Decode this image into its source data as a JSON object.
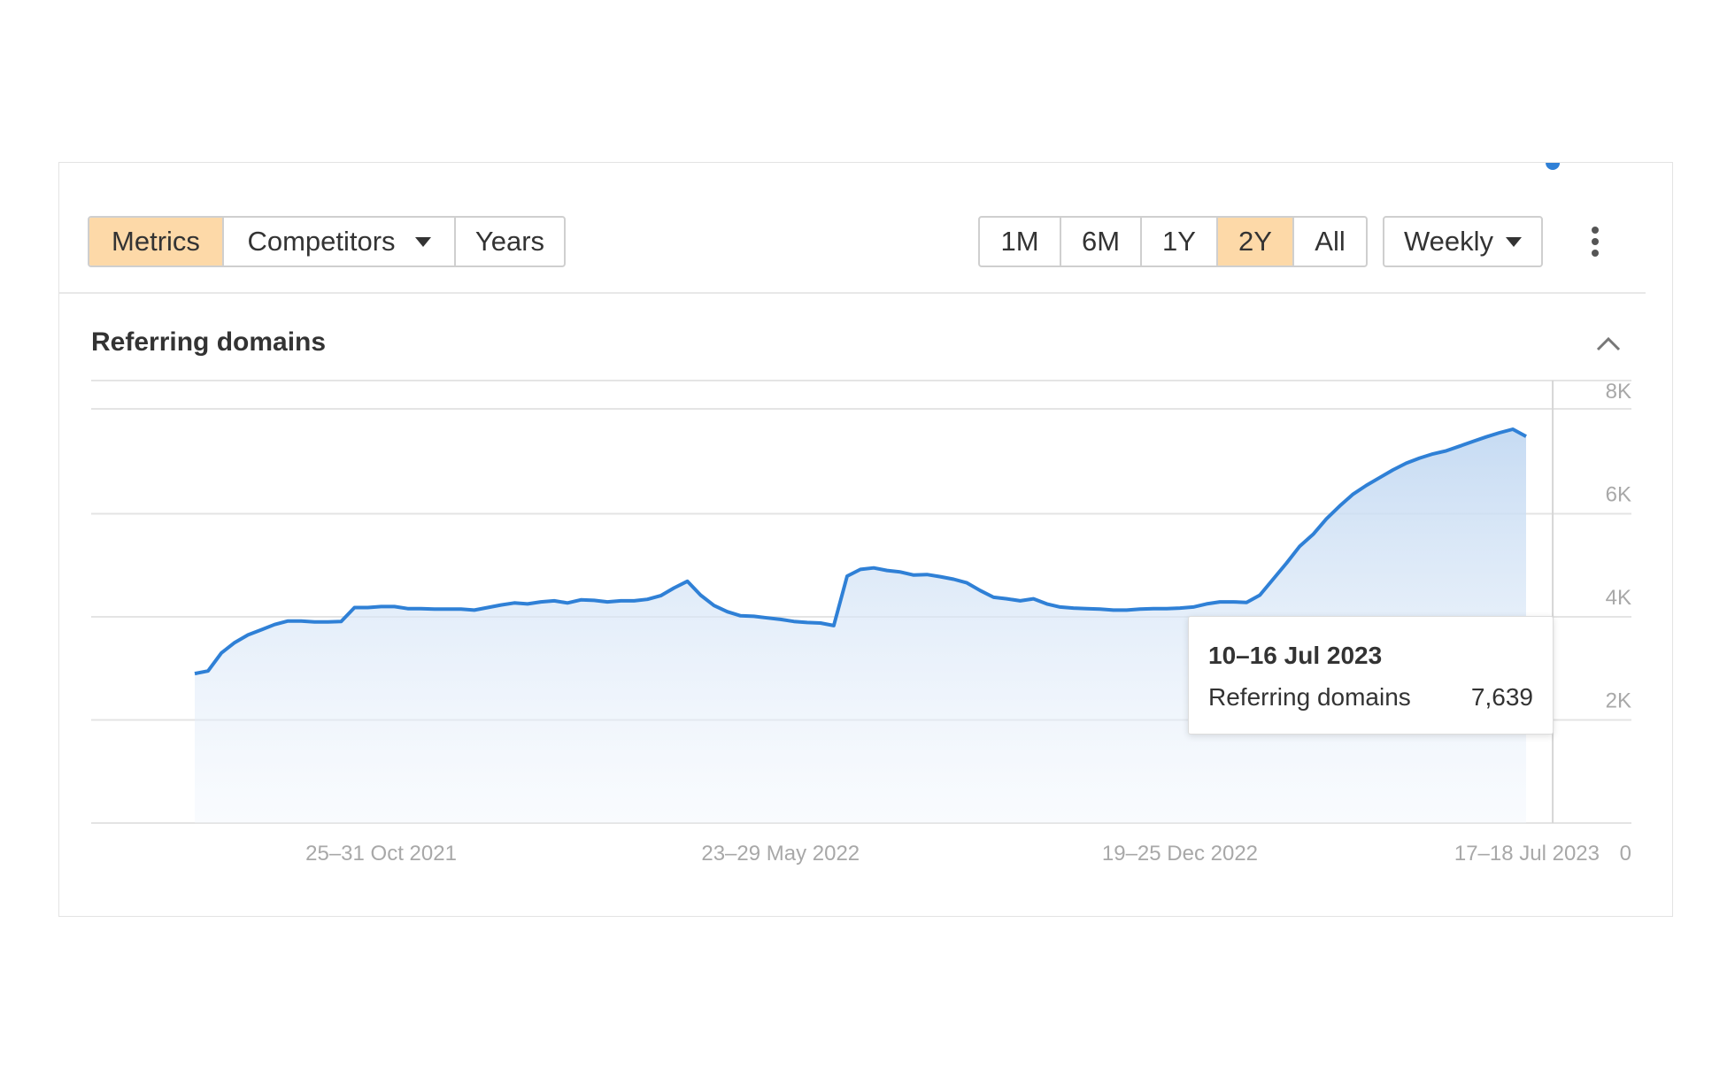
{
  "toolbar": {
    "view_tabs": [
      {
        "label": "Metrics",
        "active": true
      },
      {
        "label": "Competitors",
        "active": false
      },
      {
        "label": "Years",
        "active": false
      }
    ],
    "ranges": [
      {
        "label": "1M",
        "active": false
      },
      {
        "label": "6M",
        "active": false
      },
      {
        "label": "1Y",
        "active": false
      },
      {
        "label": "2Y",
        "active": true
      },
      {
        "label": "All",
        "active": false
      }
    ],
    "interval": {
      "selected": "Weekly"
    },
    "more_icon": "kebab-menu-icon",
    "accent_active": "#fdd9a8"
  },
  "section": {
    "title": "Referring domains",
    "collapse_icon": "chevron-up-icon"
  },
  "tooltip": {
    "title": "10–16 Jul 2023",
    "label": "Referring domains",
    "value": "7,639"
  },
  "chart_data": {
    "type": "area",
    "title": "",
    "series": [
      {
        "name": "Referring domains",
        "color": "#2f80d6",
        "values": [
          2900,
          2950,
          3300,
          3500,
          3650,
          3750,
          3850,
          3920,
          3920,
          3900,
          3900,
          3910,
          4180,
          4180,
          4200,
          4200,
          4160,
          4160,
          4150,
          4150,
          4150,
          4130,
          4180,
          4230,
          4270,
          4250,
          4290,
          4310,
          4270,
          4330,
          4320,
          4290,
          4310,
          4310,
          4340,
          4410,
          4560,
          4690,
          4420,
          4220,
          4100,
          4020,
          4010,
          3980,
          3950,
          3910,
          3890,
          3880,
          3830,
          4790,
          4920,
          4950,
          4900,
          4870,
          4810,
          4820,
          4780,
          4730,
          4660,
          4510,
          4380,
          4350,
          4310,
          4350,
          4250,
          4190,
          4170,
          4160,
          4150,
          4130,
          4130,
          4150,
          4160,
          4160,
          4170,
          4190,
          4250,
          4290,
          4290,
          4280,
          4420,
          4730,
          5040,
          5370,
          5600,
          5900,
          6150,
          6380,
          6550,
          6700,
          6850,
          6980,
          7080,
          7160,
          7220,
          7310,
          7400,
          7490,
          7570,
          7639,
          7500
        ]
      }
    ],
    "x_tick_labels": [
      "25–31 Oct 2021",
      "23–29 May 2022",
      "19–25 Dec 2022",
      "17–18 Jul 2023"
    ],
    "x_tick_index": [
      14,
      44,
      74,
      103
    ],
    "y_ticks": [
      2000,
      4000,
      6000,
      8000
    ],
    "y_tick_labels": [
      "2K",
      "4K",
      "6K",
      "8K"
    ],
    "y_zero_label": "0",
    "ylim": [
      0,
      8000
    ],
    "grid": true,
    "highlight_index": 102
  }
}
